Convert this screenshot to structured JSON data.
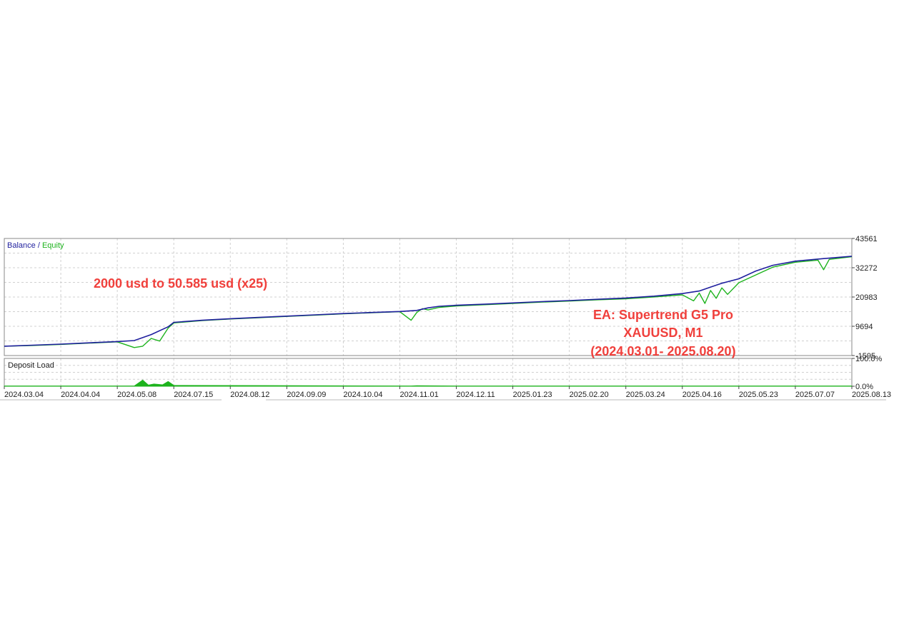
{
  "chart_data": [
    {
      "type": "line",
      "title": "",
      "legend": {
        "position": "top-left",
        "entries": [
          {
            "name": "Balance",
            "color": "#1f1f9e"
          },
          {
            "name": "Equity",
            "color": "#1db31d"
          }
        ],
        "separator": " / "
      },
      "annotations": {
        "growth": "2000 usd to 50.585 usd  (x25)",
        "ea": "EA: Supertrend G5  Pro",
        "symbol": "XAUUSD, M1",
        "period": "(2024.03.01- 2025.08.20)"
      },
      "annotation_color": "#f0403c",
      "ylim": [
        -1595,
        43561
      ],
      "y_ticks": [
        "43561",
        "32272",
        "20983",
        "9694",
        "-1595"
      ],
      "grid": true,
      "x_ticks": [
        "2024.03.04",
        "2024.04.04",
        "2024.05.08",
        "2024.07.15",
        "2024.08.12",
        "2024.09.09",
        "2024.10.04",
        "2024.11.01",
        "2024.12.11",
        "2025.01.23",
        "2025.02.20",
        "2025.03.24",
        "2025.04.16",
        "2025.05.23",
        "2025.07.07",
        "2025.08.13"
      ],
      "series": [
        {
          "name": "Balance",
          "color": "#1f1f9e",
          "x": [
            0,
            0.5,
            1,
            1.5,
            2,
            2.3,
            2.6,
            2.9,
            3,
            3.5,
            4,
            4.5,
            5,
            5.5,
            6,
            6.5,
            7,
            7.3,
            7.5,
            7.7,
            8,
            8.5,
            9,
            9.5,
            10,
            10.5,
            11,
            11.5,
            12,
            12.3,
            12.5,
            12.7,
            13,
            13.3,
            13.6,
            14,
            14.5,
            15
          ],
          "y": [
            2000,
            2400,
            2800,
            3300,
            3800,
            4200,
            6500,
            9500,
            11200,
            12000,
            12600,
            13100,
            13600,
            14100,
            14600,
            15000,
            15400,
            15800,
            16800,
            17400,
            17800,
            18200,
            18700,
            19200,
            19600,
            20100,
            20600,
            21300,
            22300,
            23300,
            24800,
            26300,
            28000,
            31000,
            33200,
            34800,
            35800,
            36700
          ]
        },
        {
          "name": "Equity",
          "color": "#1db31d",
          "x": [
            0,
            0.5,
            1,
            1.5,
            2,
            2.3,
            2.45,
            2.6,
            2.75,
            2.9,
            3,
            3.5,
            4,
            4.5,
            5,
            5.5,
            6,
            6.5,
            7,
            7.2,
            7.3,
            7.4,
            7.5,
            7.7,
            8,
            8.5,
            9,
            9.5,
            10,
            10.5,
            11,
            11.5,
            12,
            12.2,
            12.3,
            12.4,
            12.5,
            12.6,
            12.7,
            12.8,
            13,
            13.3,
            13.6,
            14,
            14.4,
            14.5,
            14.6,
            15
          ],
          "y": [
            2000,
            2300,
            2700,
            3200,
            3700,
            1500,
            2000,
            5000,
            4000,
            9000,
            11000,
            11900,
            12500,
            13000,
            13500,
            14000,
            14500,
            14900,
            15300,
            12000,
            15000,
            16500,
            16000,
            17000,
            17500,
            18000,
            18500,
            19000,
            19400,
            19900,
            20300,
            21000,
            21800,
            19500,
            22500,
            18500,
            23500,
            20500,
            24500,
            22000,
            26500,
            29500,
            32500,
            34400,
            35200,
            31500,
            35500,
            36500
          ]
        }
      ]
    },
    {
      "type": "area",
      "title": "Deposit Load",
      "ylim": [
        0,
        100
      ],
      "y_ticks": [
        "100.0%",
        "0.0%"
      ],
      "grid": true,
      "x": [
        0,
        2.3,
        2.45,
        2.55,
        2.65,
        2.8,
        2.9,
        3,
        7.2,
        7.3,
        8,
        15
      ],
      "values": [
        1,
        1,
        22,
        4,
        8,
        5,
        17,
        3,
        1,
        2,
        1,
        1
      ]
    }
  ],
  "colors": {
    "panel_border": "#8a8a8a",
    "grid": "#d0d0d0",
    "background": "#ffffff"
  }
}
